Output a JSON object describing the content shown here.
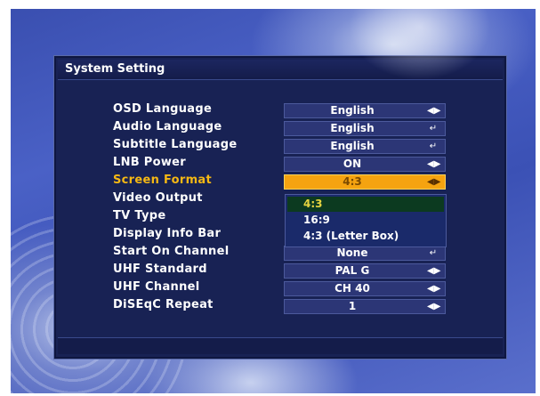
{
  "window": {
    "title": "System Setting"
  },
  "settings": [
    {
      "label": "OSD Language",
      "value": "English",
      "icon": "left-right-arrows-icon"
    },
    {
      "label": "Audio Language",
      "value": "English",
      "icon": "enter-icon"
    },
    {
      "label": "Subtitle Language",
      "value": "English",
      "icon": "enter-icon"
    },
    {
      "label": "LNB Power",
      "value": "ON",
      "icon": "left-right-arrows-icon"
    },
    {
      "label": "Screen Format",
      "value": "4:3",
      "icon": "left-right-arrows-icon",
      "active": true
    },
    {
      "label": "Video Output",
      "value": ""
    },
    {
      "label": "TV Type",
      "value": ""
    },
    {
      "label": "Display Info Bar",
      "value": ""
    },
    {
      "label": "Start On Channel",
      "value": "None",
      "icon": "enter-icon"
    },
    {
      "label": "UHF Standard",
      "value": "PAL G",
      "icon": "left-right-arrows-icon"
    },
    {
      "label": "UHF Channel",
      "value": "CH 40",
      "icon": "left-right-arrows-icon"
    },
    {
      "label": "DiSEqC Repeat",
      "value": "1",
      "icon": "left-right-arrows-icon"
    }
  ],
  "dropdown": {
    "options": [
      "4:3",
      "16:9",
      "4:3 (Letter Box)"
    ],
    "selected": "4:3"
  },
  "colors": {
    "active_label": "#f5b814",
    "active_value_bg": "#f5a310",
    "panel_bg": "#182254",
    "selected_option_bg": "#0c3a20"
  }
}
